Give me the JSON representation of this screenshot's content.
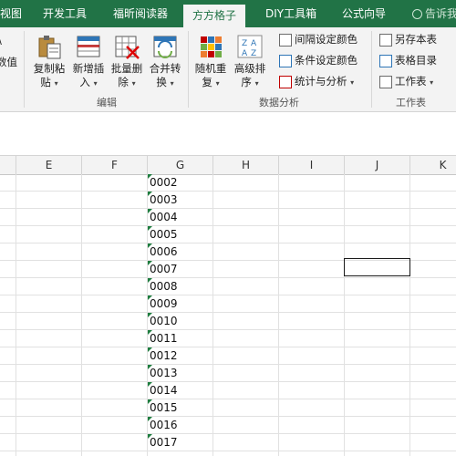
{
  "tabs": [
    {
      "label": "视图",
      "active": false
    },
    {
      "label": "开发工具",
      "active": false
    },
    {
      "label": "福昕阅读器",
      "active": false
    },
    {
      "label": "方方格子",
      "active": true
    },
    {
      "label": "DIY工具箱",
      "active": false
    },
    {
      "label": "公式向导",
      "active": false
    }
  ],
  "tell_me": "告诉我",
  "ribbon": {
    "partial_left": {
      "line1": "\\",
      "line2": "数值"
    },
    "edit_group": {
      "label": "编辑",
      "buttons": [
        {
          "line1": "复制粘",
          "line2": "贴",
          "icon": "copy-paste-icon"
        },
        {
          "line1": "新增插",
          "line2": "入",
          "icon": "insert-icon"
        },
        {
          "line1": "批量删",
          "line2": "除",
          "icon": "batch-delete-icon"
        },
        {
          "line1": "合并转",
          "line2": "换",
          "icon": "merge-convert-icon"
        }
      ]
    },
    "analysis_group": {
      "label": "数据分析",
      "buttons": [
        {
          "line1": "随机重",
          "line2": "复",
          "icon": "random-repeat-icon"
        },
        {
          "line1": "高级排",
          "line2": "序",
          "icon": "advanced-sort-icon"
        }
      ],
      "small": [
        "间隔设定颜色",
        "条件设定颜色",
        "统计与分析"
      ]
    },
    "worksheet_group": {
      "label": "工作表",
      "small": [
        "另存本表",
        "表格目录",
        "工作表"
      ]
    }
  },
  "columns": [
    "E",
    "F",
    "G",
    "H",
    "I",
    "J",
    "K"
  ],
  "g_values": [
    "0002",
    "0003",
    "0004",
    "0005",
    "0006",
    "0007",
    "0008",
    "0009",
    "0010",
    "0011",
    "0012",
    "0013",
    "0014",
    "0015",
    "0016",
    "0017"
  ],
  "colors": {
    "brand": "#217346",
    "ribbon_bg": "#f3f3f3",
    "text_warning_marker": "#1e7d3f"
  }
}
